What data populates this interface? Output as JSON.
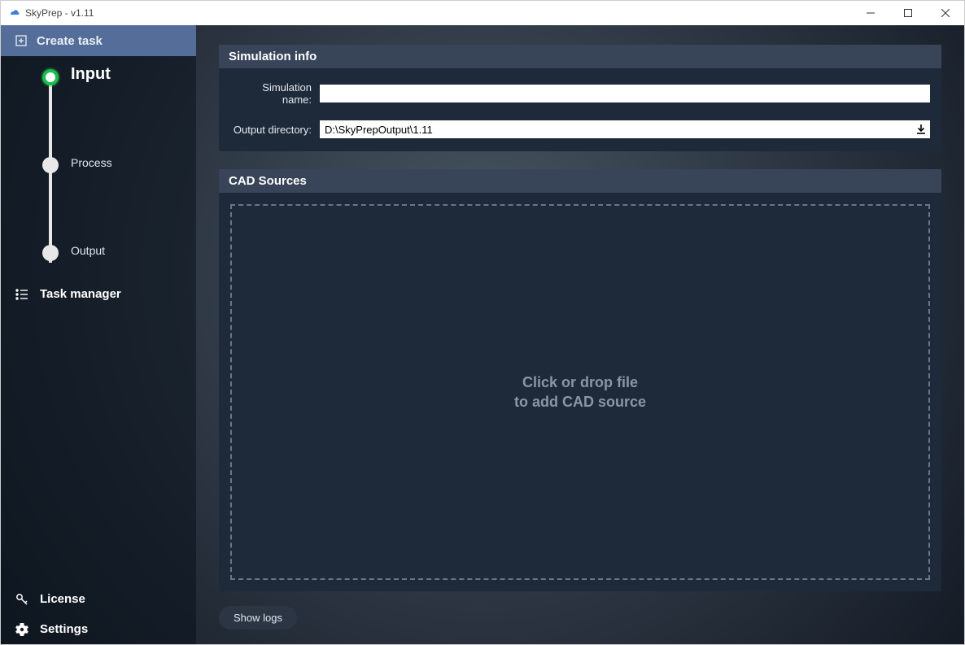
{
  "window": {
    "title": "SkyPrep - v1.11"
  },
  "sidebar": {
    "create_task_label": "Create task",
    "steps": {
      "input": "Input",
      "process": "Process",
      "output": "Output"
    },
    "task_manager_label": "Task manager",
    "license_label": "License",
    "settings_label": "Settings"
  },
  "main": {
    "sim_info_header": "Simulation info",
    "sim_name_label": "Simulation name:",
    "sim_name_value": "",
    "output_dir_label": "Output directory:",
    "output_dir_value": "D:\\SkyPrepOutput\\1.11",
    "cad_header": "CAD Sources",
    "dropzone_line1": "Click or drop file",
    "dropzone_line2": "to add CAD source",
    "show_logs_label": "Show logs"
  }
}
